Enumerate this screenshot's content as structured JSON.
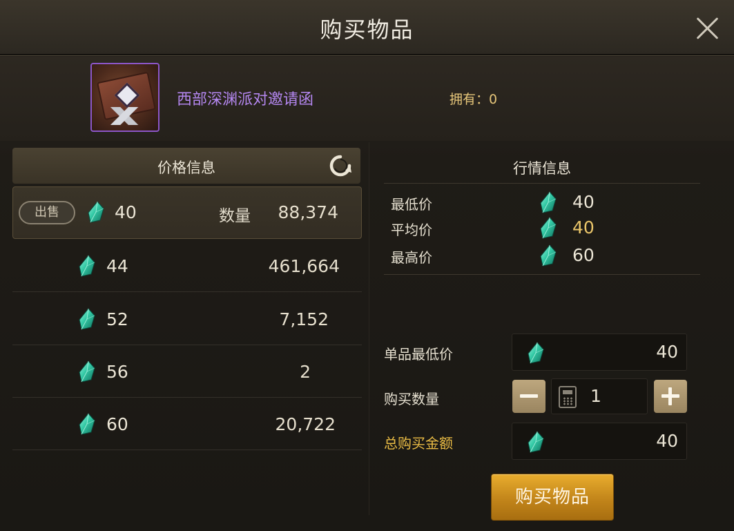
{
  "dialog": {
    "title": "购买物品"
  },
  "item": {
    "name": "西部深渊派对邀请函",
    "owned_label": "拥有：0"
  },
  "price_panel": {
    "header": "价格信息",
    "sell_badge": "出售",
    "qty_label": "数量",
    "listings": [
      {
        "price": "40",
        "quantity": "88,374"
      },
      {
        "price": "44",
        "quantity": "461,664"
      },
      {
        "price": "52",
        "quantity": "7,152"
      },
      {
        "price": "56",
        "quantity": "2"
      },
      {
        "price": "60",
        "quantity": "20,722"
      }
    ]
  },
  "market_panel": {
    "header": "行情信息",
    "rows": [
      {
        "label": "最低价",
        "value": "40"
      },
      {
        "label": "平均价",
        "value": "40"
      },
      {
        "label": "最高价",
        "value": "60"
      }
    ]
  },
  "purchase_form": {
    "unit_min_label": "单品最低价",
    "unit_min_value": "40",
    "quantity_label": "购买数量",
    "quantity_value": "1",
    "total_label": "总购买金额",
    "total_value": "40",
    "buy_button": "购买物品"
  },
  "colors": {
    "item_name": "#b487f0",
    "owned_text": "#e6c67a",
    "average_price": "#ebc66a",
    "total_label": "#ebbd45",
    "buy_button": "#d89a25",
    "gem": "#33c9a5"
  },
  "icons": [
    "close-icon",
    "refresh-icon",
    "gem-icon",
    "calculator-icon",
    "minus-icon",
    "plus-icon",
    "invitation-item-icon"
  ]
}
